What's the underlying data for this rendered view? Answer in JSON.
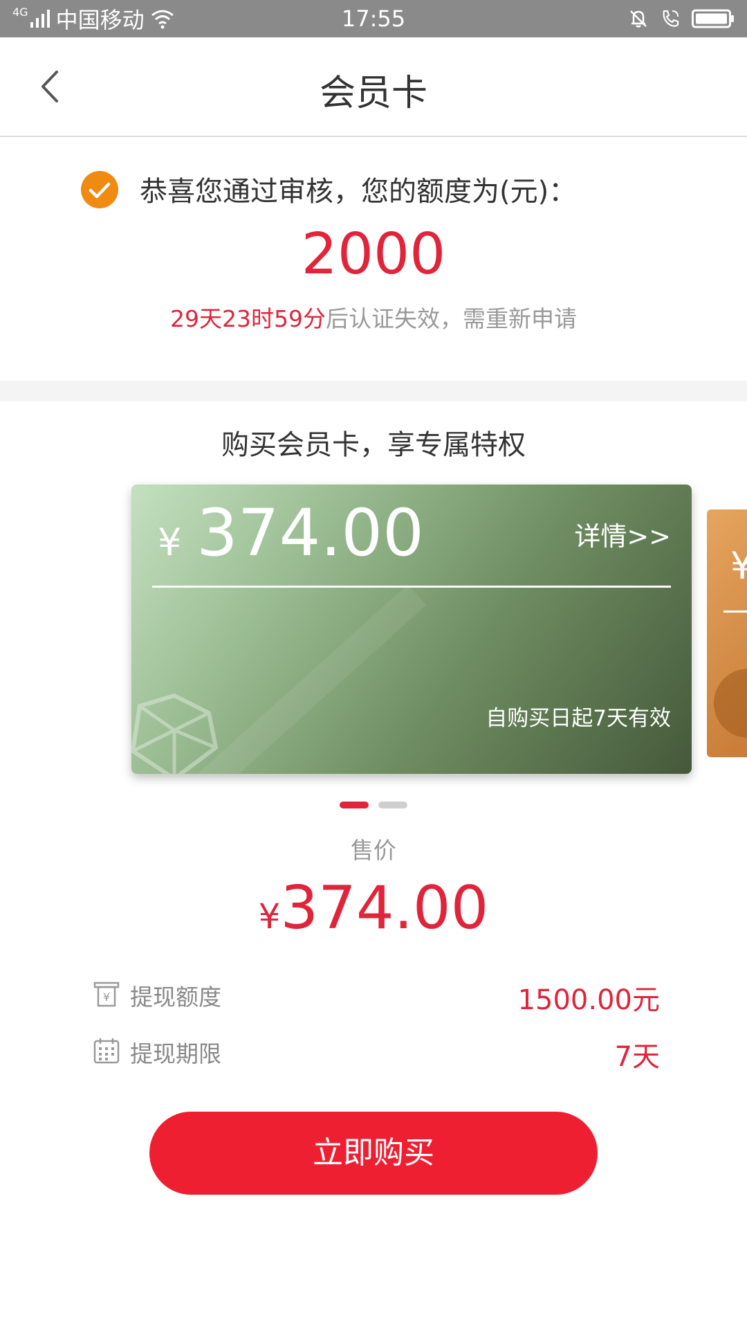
{
  "status_bar": {
    "network": "4G",
    "carrier": "中国移动",
    "time": "17:55"
  },
  "nav": {
    "title": "会员卡"
  },
  "approval": {
    "message": "恭喜您通过审核，您的额度为(元)：",
    "credit_amount": "2000",
    "countdown_red": "29天23时59分",
    "countdown_gray": "后认证失效，需重新申请"
  },
  "purchase": {
    "section_title": "购买会员卡，享专属特权",
    "cards": [
      {
        "currency": "¥",
        "amount": "374.00",
        "detail_link": "详情>>",
        "validity": "自购买日起7天有效"
      },
      {
        "currency": "¥"
      }
    ],
    "carousel_index": 0,
    "carousel_total": 2,
    "price_label": "售价",
    "price_currency": "¥",
    "price_value": "374.00",
    "rows": [
      {
        "icon": "withdraw-limit-icon",
        "label": "提现额度",
        "value": "1500.00元"
      },
      {
        "icon": "calendar-icon",
        "label": "提现期限",
        "value": "7天"
      }
    ],
    "buy_button": "立即购买"
  },
  "colors": {
    "accent_red": "#e0243a",
    "button_red": "#ef1f32",
    "check_orange": "#f08a10"
  }
}
